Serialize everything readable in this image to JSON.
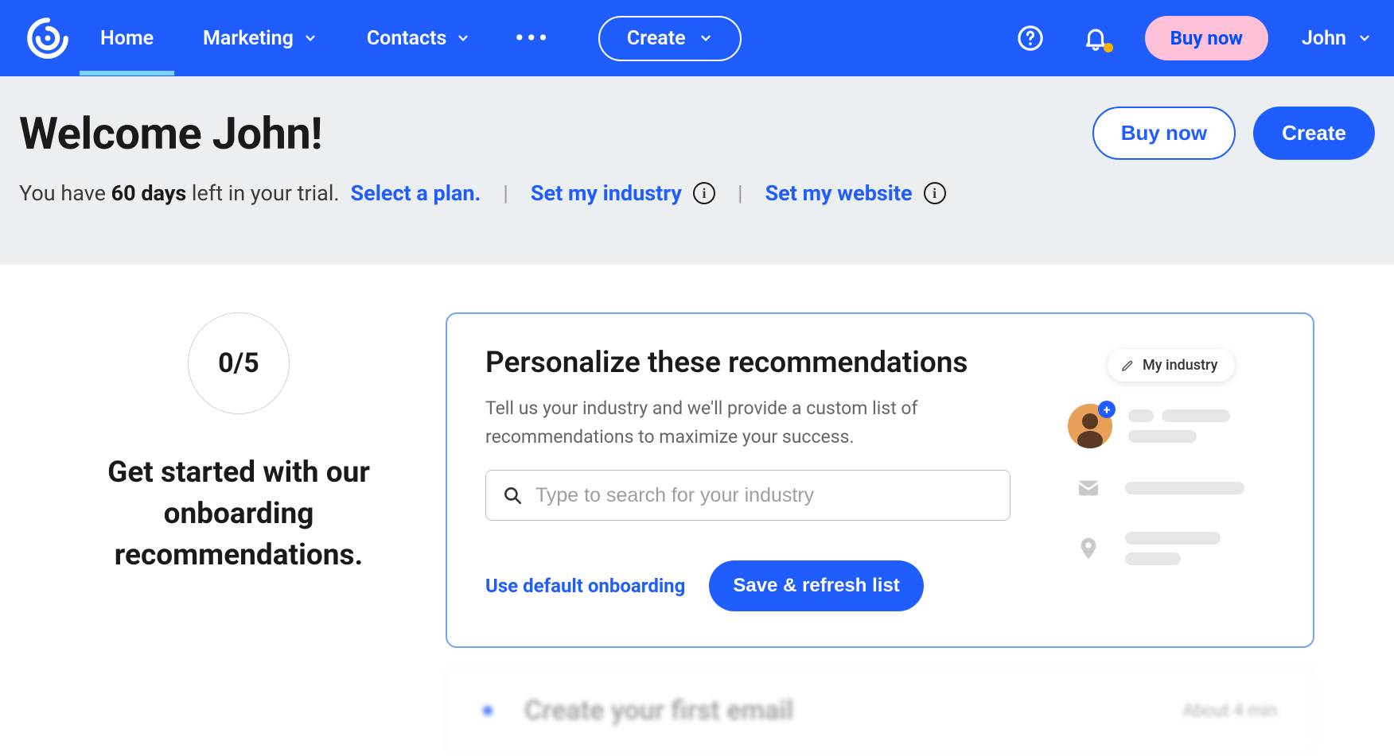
{
  "nav": {
    "home": "Home",
    "marketing": "Marketing",
    "contacts": "Contacts",
    "create": "Create",
    "buy_now": "Buy now",
    "user": "John"
  },
  "hero": {
    "title": "Welcome John!",
    "trial_prefix": "You have ",
    "trial_days": "60 days",
    "trial_suffix": " left in your trial. ",
    "select_plan": "Select a plan.",
    "set_industry": "Set my industry",
    "set_website": "Set my website",
    "buy_now": "Buy now",
    "create": "Create"
  },
  "onboarding": {
    "progress": "0/5",
    "left_title": "Get started with our onboarding recommendations.",
    "card_title": "Personalize these recommendations",
    "card_desc": "Tell us your industry and we'll provide a custom list of recommendations to maximize your success.",
    "search_placeholder": "Type to search for your industry",
    "default_link": "Use default onboarding",
    "save_btn": "Save & refresh list",
    "my_industry_chip": "My industry"
  },
  "next_item": {
    "title": "Create your first email",
    "time": "About 4 min"
  }
}
